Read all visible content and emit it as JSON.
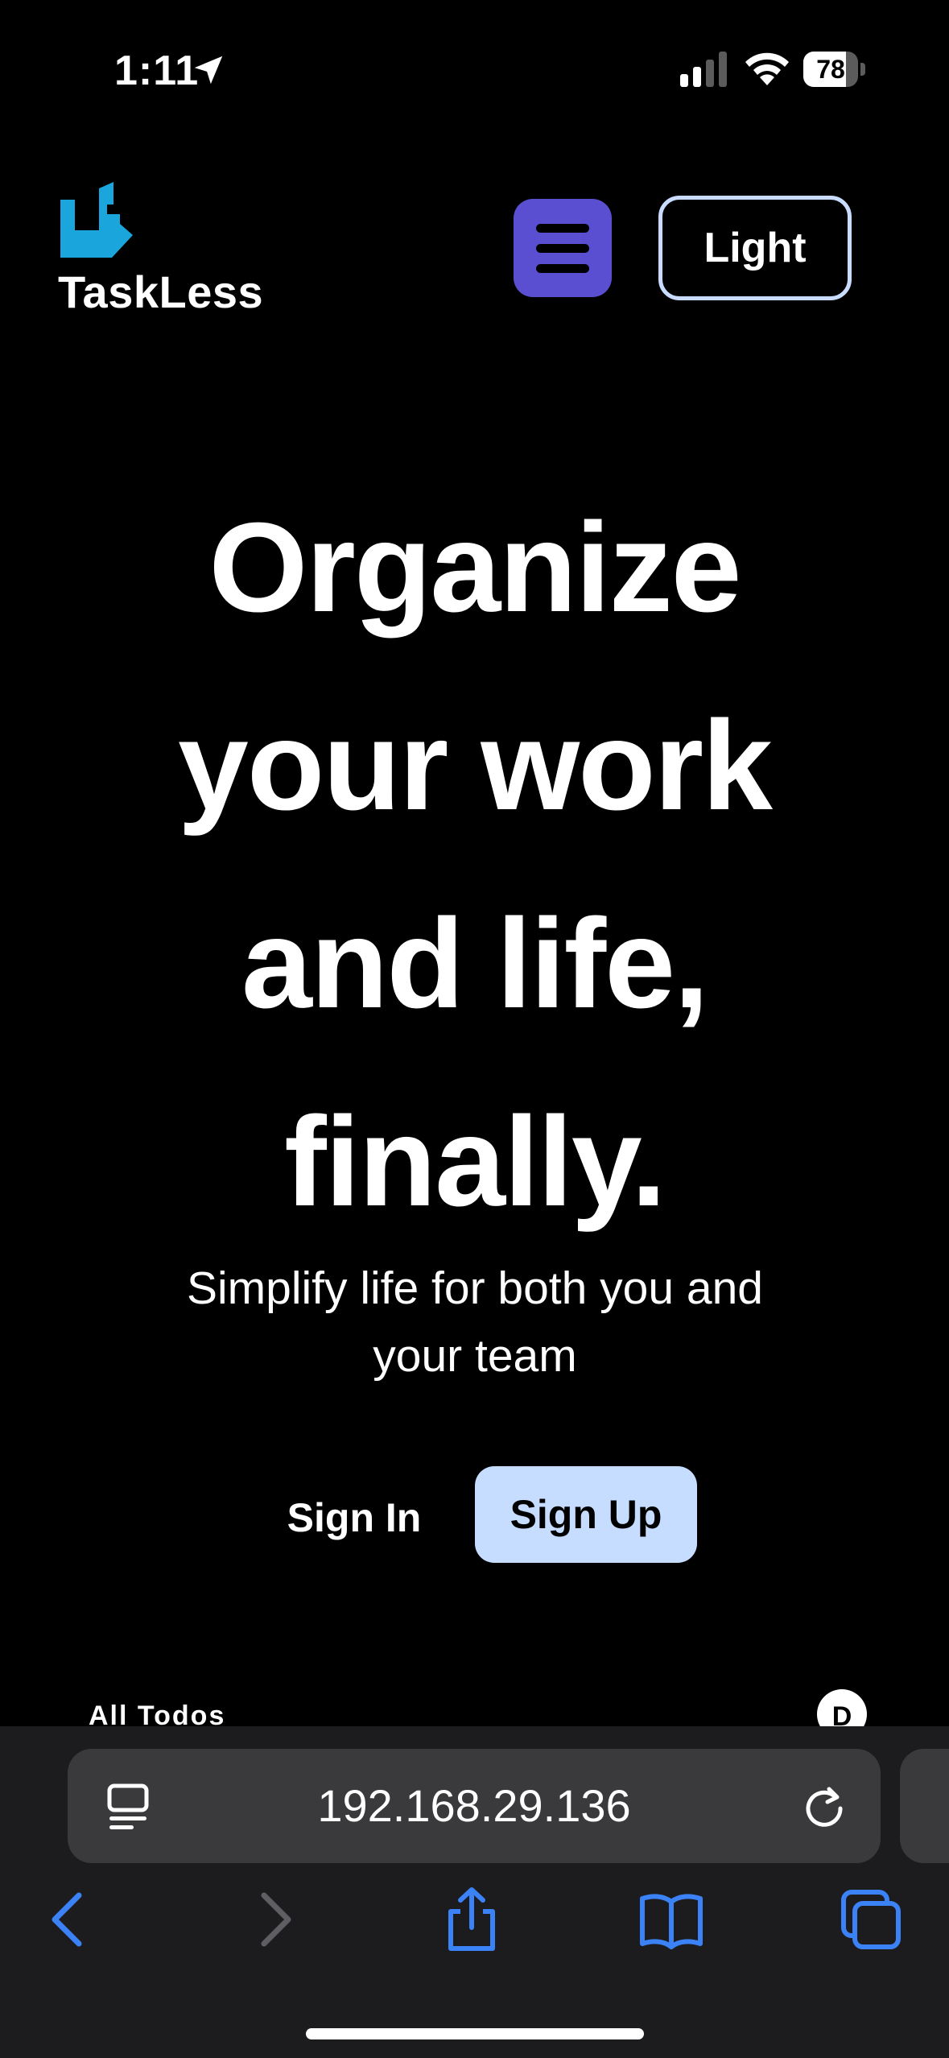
{
  "status_bar": {
    "time": "1:11",
    "battery_percent": "78",
    "battery_level": 0.78,
    "icons": [
      "location-arrow-icon",
      "cellular-signal-icon",
      "wifi-icon",
      "battery-icon"
    ]
  },
  "header": {
    "brand": "TaskLess",
    "menu_icon": "hamburger-menu-icon",
    "theme_toggle_label": "Light",
    "colors": {
      "menu_button_bg": "#5b4fd1",
      "logo_accent": "#1aa6dc",
      "theme_border": "#c9dcff"
    }
  },
  "hero": {
    "title_lines": [
      "Organize",
      "your work",
      "and life,",
      "finally."
    ],
    "subtitle_lines": [
      "Simplify life for both you and",
      "your team"
    ],
    "sign_in_label": "Sign In",
    "sign_up_label": "Sign Up",
    "colors": {
      "sign_up_bg": "#c6ddff"
    }
  },
  "preview": {
    "section_label": "All Todos",
    "avatar_initial": "D"
  },
  "browser": {
    "url": "192.168.29.136",
    "icons": [
      "page-menu-icon",
      "reload-icon",
      "back-icon",
      "forward-icon",
      "share-icon",
      "bookmarks-icon",
      "tabs-icon"
    ],
    "accent": "#3b82f6"
  }
}
